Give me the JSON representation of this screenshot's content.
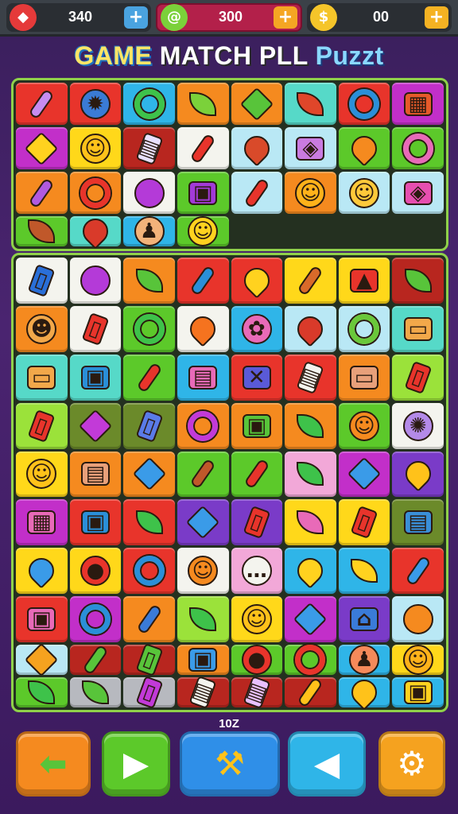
{
  "hud": {
    "resources": [
      {
        "icon": "red-crystal-icon",
        "value": "340",
        "plus_color": "#4aa3e0",
        "icon_color": "#e53a3a"
      },
      {
        "icon": "green-swirl-icon",
        "value": "300",
        "plus_color": "#f5a623",
        "icon_color": "#7bd13a"
      },
      {
        "icon": "gold-coin-icon",
        "value": "00",
        "plus_color": "#f5b223",
        "icon_color": "#f5c52a"
      }
    ]
  },
  "title": {
    "part1": "GAME",
    "part2": "MATCH PLL",
    "part3": "Puzzt"
  },
  "level_label": "10Z",
  "colors": {
    "red": "#e8342b",
    "blue": "#2fb5e8",
    "orange": "#f58a1f",
    "green": "#5cc92a",
    "teal": "#56d9c8",
    "magenta": "#c22fc9",
    "yellow": "#ffd81a",
    "white": "#f4f4ee",
    "lightblue": "#b9e8f5",
    "pink": "#f2a8d8",
    "purple": "#7a3bc8",
    "darkred": "#b8261f",
    "olive": "#6b8a2a",
    "gray": "#b7b9bf",
    "lime": "#9be23a"
  },
  "board_top": {
    "tiles": [
      {
        "bg": "red",
        "icon": "candy-bar-icon",
        "shape": "bar",
        "fg": "#c78cf0",
        "sym": ""
      },
      {
        "bg": "red",
        "icon": "blue-sun-icon",
        "shape": "face",
        "fg": "#3a7bd5",
        "sym": "✹"
      },
      {
        "bg": "blue",
        "icon": "green-leaf-icon",
        "shape": "ring",
        "fg": "#3ec24a",
        "sym": ""
      },
      {
        "bg": "orange",
        "icon": "green-tree-icon",
        "shape": "leaf",
        "fg": "#7bd13a",
        "sym": ""
      },
      {
        "bg": "orange",
        "icon": "green-monster-icon",
        "shape": "star",
        "fg": "#58c43a",
        "sym": ""
      },
      {
        "bg": "teal",
        "icon": "red-leaf-icon",
        "shape": "leaf",
        "fg": "#e0462a",
        "sym": ""
      },
      {
        "bg": "red",
        "icon": "blue-ring-icon",
        "shape": "ring",
        "fg": "#2a8fd8",
        "sym": ""
      },
      {
        "bg": "magenta",
        "icon": "gift-box-icon",
        "shape": "box",
        "fg": "#e65a2a",
        "sym": "▦"
      },
      {
        "bg": "magenta",
        "icon": "yellow-gear-icon",
        "shape": "star",
        "fg": "#ffd21f",
        "sym": ""
      },
      {
        "bg": "yellow",
        "icon": "smiley-face-icon",
        "shape": "face",
        "fg": "#ffc21a",
        "sym": "☺"
      },
      {
        "bg": "darkred",
        "icon": "calculator-icon",
        "shape": "phone",
        "fg": "#e8e0ff",
        "sym": "▤"
      },
      {
        "bg": "white",
        "icon": "red-pencil-icon",
        "shape": "bar",
        "fg": "#e8342b",
        "sym": ""
      },
      {
        "bg": "lightblue",
        "icon": "red-bottle-icon",
        "shape": "drop",
        "fg": "#d94a2a",
        "sym": ""
      },
      {
        "bg": "lightblue",
        "icon": "purple-card-icon",
        "shape": "box",
        "fg": "#c97be0",
        "sym": "◈"
      },
      {
        "bg": "green",
        "icon": "orange-drop-icon",
        "shape": "drop",
        "fg": "#f58a1f",
        "sym": ""
      },
      {
        "bg": "green",
        "icon": "pink-magnifier-icon",
        "shape": "ring",
        "fg": "#e86ab8",
        "sym": ""
      },
      {
        "bg": "orange",
        "icon": "purple-crayon-icon",
        "shape": "bar",
        "fg": "#b05ae0",
        "sym": ""
      },
      {
        "bg": "orange",
        "icon": "red-donut-icon",
        "shape": "ring",
        "fg": "#e8342b",
        "sym": ""
      },
      {
        "bg": "white",
        "icon": "purple-orb-icon",
        "shape": "face",
        "fg": "#b43ad8",
        "sym": ""
      },
      {
        "bg": "green",
        "icon": "purple-bag-icon",
        "shape": "box",
        "fg": "#a23ad8",
        "sym": "▣"
      },
      {
        "bg": "lightblue",
        "icon": "red-battery-icon",
        "shape": "bar",
        "fg": "#e8342b",
        "sym": ""
      },
      {
        "bg": "orange",
        "icon": "orange-face-icon",
        "shape": "face",
        "fg": "#ffb21a",
        "sym": "☺"
      },
      {
        "bg": "lightblue",
        "icon": "smiley-face-icon",
        "shape": "face",
        "fg": "#ffc93a",
        "sym": "☺"
      },
      {
        "bg": "lightblue",
        "icon": "pink-card-icon",
        "shape": "box",
        "fg": "#e64fb0",
        "sym": "◈"
      },
      {
        "bg": "green",
        "icon": "brown-leaf-icon",
        "shape": "leaf",
        "fg": "#c0582a",
        "sym": ""
      },
      {
        "bg": "teal",
        "icon": "red-lamp-icon",
        "shape": "drop",
        "fg": "#d93a2a",
        "sym": ""
      },
      {
        "bg": "blue",
        "icon": "pawn-figure-icon",
        "shape": "face",
        "fg": "#f2b27a",
        "sym": "♟"
      },
      {
        "bg": "green",
        "icon": "yellow-face-icon",
        "shape": "face",
        "fg": "#ffd21f",
        "sym": "☺"
      }
    ]
  },
  "board_main": {
    "tiles": [
      {
        "bg": "white",
        "icon": "phone-card-icon",
        "shape": "phone",
        "fg": "#2a6fd8",
        "sym": "▯"
      },
      {
        "bg": "white",
        "icon": "purple-orb-icon",
        "shape": "face",
        "fg": "#b43ad8",
        "sym": ""
      },
      {
        "bg": "orange",
        "icon": "green-leaf-icon",
        "shape": "leaf",
        "fg": "#58c43a",
        "sym": ""
      },
      {
        "bg": "red",
        "icon": "blue-crayon-icon",
        "shape": "bar",
        "fg": "#2a8fd8",
        "sym": ""
      },
      {
        "bg": "red",
        "icon": "yellow-key-icon",
        "shape": "drop",
        "fg": "#ffd21f",
        "sym": ""
      },
      {
        "bg": "yellow",
        "icon": "microphone-icon",
        "shape": "bar",
        "fg": "#d96a2a",
        "sym": ""
      },
      {
        "bg": "yellow",
        "icon": "cake-icon",
        "shape": "box",
        "fg": "#e8342b",
        "sym": "▲"
      },
      {
        "bg": "darkred",
        "icon": "palm-tree-icon",
        "shape": "leaf",
        "fg": "#58c43a",
        "sym": ""
      },
      {
        "bg": "orange",
        "icon": "bear-face-icon",
        "shape": "face",
        "fg": "#f2a84a",
        "sym": "☻"
      },
      {
        "bg": "white",
        "icon": "red-phone-icon",
        "shape": "phone",
        "fg": "#e8342b",
        "sym": "▯"
      },
      {
        "bg": "green",
        "icon": "search-icon",
        "shape": "ring",
        "fg": "#3ec24a",
        "sym": ""
      },
      {
        "bg": "white",
        "icon": "orange-flame-icon",
        "shape": "drop",
        "fg": "#f5731f",
        "sym": ""
      },
      {
        "bg": "blue",
        "icon": "pink-octopus-icon",
        "shape": "face",
        "fg": "#e86ab8",
        "sym": "✿"
      },
      {
        "bg": "lightblue",
        "icon": "red-sock-icon",
        "shape": "drop",
        "fg": "#d93a2a",
        "sym": ""
      },
      {
        "bg": "lightblue",
        "icon": "green-ring-icon",
        "shape": "ring",
        "fg": "#6ac83a",
        "sym": ""
      },
      {
        "bg": "teal",
        "icon": "road-sign-icon",
        "shape": "box",
        "fg": "#f2a84a",
        "sym": "▭"
      },
      {
        "bg": "teal",
        "icon": "road-sign-icon",
        "shape": "box",
        "fg": "#f2a84a",
        "sym": "▭"
      },
      {
        "bg": "teal",
        "icon": "green-box-icon",
        "shape": "box",
        "fg": "#2a8fd8",
        "sym": "▣"
      },
      {
        "bg": "green",
        "icon": "red-pencil-icon",
        "shape": "bar",
        "fg": "#e8342b",
        "sym": ""
      },
      {
        "bg": "blue",
        "icon": "pink-basket-icon",
        "shape": "box",
        "fg": "#e86ab8",
        "sym": "▤"
      },
      {
        "bg": "red",
        "icon": "blue-gift-icon",
        "shape": "box",
        "fg": "#5a5ad8",
        "sym": "✕"
      },
      {
        "bg": "red",
        "icon": "calculator-icon",
        "shape": "phone",
        "fg": "#f4f4ee",
        "sym": "▤"
      },
      {
        "bg": "orange",
        "icon": "jar-icon",
        "shape": "box",
        "fg": "#e8a07a",
        "sym": "▭"
      },
      {
        "bg": "lime",
        "icon": "red-phone-icon",
        "shape": "phone",
        "fg": "#e8342b",
        "sym": "▯"
      },
      {
        "bg": "lime",
        "icon": "red-phone-icon",
        "shape": "phone",
        "fg": "#e8342b",
        "sym": "▯"
      },
      {
        "bg": "olive",
        "icon": "purple-bow-icon",
        "shape": "star",
        "fg": "#c23ad8",
        "sym": ""
      },
      {
        "bg": "olive",
        "icon": "blue-phone-icon",
        "shape": "phone",
        "fg": "#5a7be8",
        "sym": "▯"
      },
      {
        "bg": "orange",
        "icon": "purple-ring-icon",
        "shape": "ring",
        "fg": "#c23ad8",
        "sym": ""
      },
      {
        "bg": "orange",
        "icon": "green-chest-icon",
        "shape": "box",
        "fg": "#58c43a",
        "sym": "▣"
      },
      {
        "bg": "orange",
        "icon": "palm-tree-icon",
        "shape": "leaf",
        "fg": "#3ec24a",
        "sym": ""
      },
      {
        "bg": "green",
        "icon": "orange-face-icon",
        "shape": "face",
        "fg": "#f58a1f",
        "sym": "☺"
      },
      {
        "bg": "white",
        "icon": "purple-gear-icon",
        "shape": "face",
        "fg": "#b48ae8",
        "sym": "✺"
      },
      {
        "bg": "yellow",
        "icon": "yellow-face-icon",
        "shape": "face",
        "fg": "#ffc21a",
        "sym": "☺"
      },
      {
        "bg": "orange",
        "icon": "wooden-chest-icon",
        "shape": "box",
        "fg": "#e8a07a",
        "sym": "▤"
      },
      {
        "bg": "orange",
        "icon": "blue-star-icon",
        "shape": "star",
        "fg": "#3a9be8",
        "sym": ""
      },
      {
        "bg": "green",
        "icon": "brown-crayon-icon",
        "shape": "bar",
        "fg": "#c0582a",
        "sym": ""
      },
      {
        "bg": "green",
        "icon": "red-pencil-icon",
        "shape": "bar",
        "fg": "#e8342b",
        "sym": ""
      },
      {
        "bg": "pink",
        "icon": "palm-tree-icon",
        "shape": "leaf",
        "fg": "#3ec24a",
        "sym": ""
      },
      {
        "bg": "magenta",
        "icon": "blue-flower-icon",
        "shape": "star",
        "fg": "#3a9be8",
        "sym": ""
      },
      {
        "bg": "purple",
        "icon": "yellow-heart-icon",
        "shape": "drop",
        "fg": "#ffc21a",
        "sym": ""
      },
      {
        "bg": "magenta",
        "icon": "pink-box-icon",
        "shape": "box",
        "fg": "#e86ab8",
        "sym": "▦"
      },
      {
        "bg": "red",
        "icon": "blue-bag-icon",
        "shape": "box",
        "fg": "#2a8fd8",
        "sym": "▣"
      },
      {
        "bg": "red",
        "icon": "palm-tree-icon",
        "shape": "leaf",
        "fg": "#3ec24a",
        "sym": ""
      },
      {
        "bg": "purple",
        "icon": "blue-star-icon",
        "shape": "star",
        "fg": "#3a9be8",
        "sym": ""
      },
      {
        "bg": "purple",
        "icon": "red-card-icon",
        "shape": "phone",
        "fg": "#e8342b",
        "sym": "▯"
      },
      {
        "bg": "yellow",
        "icon": "pink-leaf-icon",
        "shape": "leaf",
        "fg": "#e86ab8",
        "sym": ""
      },
      {
        "bg": "yellow",
        "icon": "red-phone-icon",
        "shape": "phone",
        "fg": "#e8342b",
        "sym": "▯"
      },
      {
        "bg": "olive",
        "icon": "green-register-icon",
        "shape": "box",
        "fg": "#3a8fd8",
        "sym": "▤"
      },
      {
        "bg": "yellow",
        "icon": "blue-bell-icon",
        "shape": "drop",
        "fg": "#3a9be8",
        "sym": ""
      },
      {
        "bg": "yellow",
        "icon": "red-apple-icon",
        "shape": "face",
        "fg": "#e8342b",
        "sym": "●"
      },
      {
        "bg": "red",
        "icon": "search-icon",
        "shape": "ring",
        "fg": "#2a8fd8",
        "sym": ""
      },
      {
        "bg": "white",
        "icon": "orange-face-icon",
        "shape": "face",
        "fg": "#f58a1f",
        "sym": "☺"
      },
      {
        "bg": "pink",
        "icon": "speech-bubble-icon",
        "shape": "face",
        "fg": "#f4f4ee",
        "sym": "…"
      },
      {
        "bg": "blue",
        "icon": "joystick-icon",
        "shape": "drop",
        "fg": "#ffd21f",
        "sym": ""
      },
      {
        "bg": "blue",
        "icon": "yellow-leaf-icon",
        "shape": "leaf",
        "fg": "#ffd21f",
        "sym": ""
      },
      {
        "bg": "red",
        "icon": "blue-hammer-icon",
        "shape": "bar",
        "fg": "#3a9be8",
        "sym": ""
      },
      {
        "bg": "red",
        "icon": "pink-bag-icon",
        "shape": "box",
        "fg": "#e86ab8",
        "sym": "▣"
      },
      {
        "bg": "magenta",
        "icon": "search-icon",
        "shape": "ring",
        "fg": "#2a8fd8",
        "sym": ""
      },
      {
        "bg": "orange",
        "icon": "blue-crayon-icon",
        "shape": "bar",
        "fg": "#3a7bd8",
        "sym": ""
      },
      {
        "bg": "lime",
        "icon": "green-leaf-icon",
        "shape": "leaf",
        "fg": "#3ec24a",
        "sym": ""
      },
      {
        "bg": "yellow",
        "icon": "yellow-face-icon",
        "shape": "face",
        "fg": "#ffc21a",
        "sym": "☺"
      },
      {
        "bg": "magenta",
        "icon": "blue-gear-icon",
        "shape": "star",
        "fg": "#3a9be8",
        "sym": ""
      },
      {
        "bg": "purple",
        "icon": "blue-house-icon",
        "shape": "box",
        "fg": "#3a7bd8",
        "sym": "⌂"
      },
      {
        "bg": "lightblue",
        "icon": "orange-cookie-icon",
        "shape": "face",
        "fg": "#f58a1f",
        "sym": ""
      },
      {
        "bg": "lightblue",
        "icon": "orange-flower-icon",
        "shape": "star",
        "fg": "#f5a21f",
        "sym": ""
      },
      {
        "bg": "darkred",
        "icon": "green-crayon-icon",
        "shape": "bar",
        "fg": "#58c43a",
        "sym": ""
      },
      {
        "bg": "darkred",
        "icon": "green-phone-icon",
        "shape": "phone",
        "fg": "#58c43a",
        "sym": "▯"
      },
      {
        "bg": "orange",
        "icon": "blue-cube-icon",
        "shape": "box",
        "fg": "#3a9be8",
        "sym": "▣"
      },
      {
        "bg": "green",
        "icon": "red-apple-icon",
        "shape": "face",
        "fg": "#e8342b",
        "sym": "●"
      },
      {
        "bg": "green",
        "icon": "red-donut-icon",
        "shape": "ring",
        "fg": "#e8342b",
        "sym": ""
      },
      {
        "bg": "blue",
        "icon": "pawn-figure-icon",
        "shape": "face",
        "fg": "#f58a5a",
        "sym": "♟"
      },
      {
        "bg": "yellow",
        "icon": "orange-face-icon",
        "shape": "face",
        "fg": "#ffb21a",
        "sym": "☺"
      },
      {
        "bg": "green",
        "icon": "green-leaf-icon",
        "shape": "leaf",
        "fg": "#3ec24a",
        "sym": ""
      },
      {
        "bg": "gray",
        "icon": "green-leaf-icon",
        "shape": "leaf",
        "fg": "#58c43a",
        "sym": ""
      },
      {
        "bg": "gray",
        "icon": "purple-phone-icon",
        "shape": "phone",
        "fg": "#c23ad8",
        "sym": "▯"
      },
      {
        "bg": "darkred",
        "icon": "calculator-icon",
        "shape": "phone",
        "fg": "#f4f4ee",
        "sym": "▤"
      },
      {
        "bg": "darkred",
        "icon": "calculator-icon",
        "shape": "phone",
        "fg": "#e8c0ff",
        "sym": "▤"
      },
      {
        "bg": "darkred",
        "icon": "yellow-bone-icon",
        "shape": "bar",
        "fg": "#ffc21a",
        "sym": ""
      },
      {
        "bg": "blue",
        "icon": "yellow-key-icon",
        "shape": "drop",
        "fg": "#ffc21a",
        "sym": ""
      },
      {
        "bg": "blue",
        "icon": "yellow-gift-icon",
        "shape": "box",
        "fg": "#ffd21f",
        "sym": "▣"
      }
    ]
  },
  "controls": [
    {
      "name": "back-arrow-button",
      "icon": "back-arrow-icon",
      "bg": "#f58a1f",
      "fg": "#58c43a",
      "sym": "⬅"
    },
    {
      "name": "play-button",
      "icon": "play-icon",
      "bg": "#5cc92a",
      "fg": "#ffffff",
      "sym": "▶"
    },
    {
      "name": "hammer-tool-button",
      "icon": "hammer-icon",
      "bg": "#2f8fe8",
      "fg": "#ffc21a",
      "sym": "⚒"
    },
    {
      "name": "sound-button",
      "icon": "speaker-icon",
      "bg": "#2fb5e8",
      "fg": "#ffffff",
      "sym": "◀"
    },
    {
      "name": "settings-button",
      "icon": "gear-icon",
      "bg": "#f5a21f",
      "fg": "#ffffff",
      "sym": "⚙"
    }
  ]
}
